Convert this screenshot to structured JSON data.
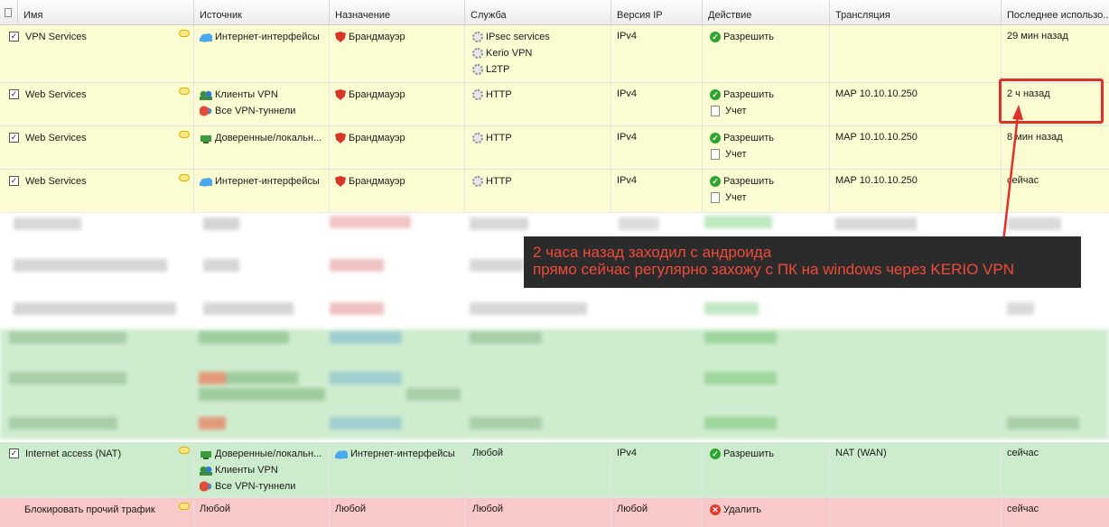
{
  "columns": [
    "Имя",
    "Источник",
    "Назначение",
    "Служба",
    "Версия IP",
    "Действие",
    "Трансляция",
    "Последнее использо..."
  ],
  "rows": [
    {
      "name": "VPN Services",
      "source": [
        "Интернет-интерфейсы"
      ],
      "destination": [
        "Брандмауэр"
      ],
      "service": [
        "IPsec services",
        "Kerio VPN",
        "L2TP"
      ],
      "ip": "IPv4",
      "action": [
        "Разрешить"
      ],
      "translation": "",
      "last": "29 мин назад"
    },
    {
      "name": "Web Services",
      "source": [
        "Клиенты VPN",
        "Все VPN-туннели"
      ],
      "destination": [
        "Брандмауэр"
      ],
      "service": [
        "HTTP"
      ],
      "ip": "IPv4",
      "action": [
        "Разрешить",
        "Учет"
      ],
      "translation": "MAP 10.10.10.250",
      "last": "2 ч назад"
    },
    {
      "name": "Web Services",
      "source": [
        "Доверенные/локальн..."
      ],
      "destination": [
        "Брандмауэр"
      ],
      "service": [
        "HTTP"
      ],
      "ip": "IPv4",
      "action": [
        "Разрешить",
        "Учет"
      ],
      "translation": "MAP 10.10.10.250",
      "last": "8 мин назад"
    },
    {
      "name": "Web Services",
      "source": [
        "Интернет-интерфейсы"
      ],
      "destination": [
        "Брандмауэр"
      ],
      "service": [
        "HTTP"
      ],
      "ip": "IPv4",
      "action": [
        "Разрешить",
        "Учет"
      ],
      "translation": "MAP 10.10.10.250",
      "last": "сейчас"
    },
    {
      "name": "Internet access (NAT)",
      "source": [
        "Доверенные/локальн...",
        "Клиенты VPN",
        "Все VPN-туннели"
      ],
      "destination": [
        "Интернет-интерфейсы"
      ],
      "service": [
        "Любой"
      ],
      "ip": "IPv4",
      "action": [
        "Разрешить"
      ],
      "translation": "NAT (WAN)",
      "last": "сейчас"
    },
    {
      "name": "Блокировать прочий трафик",
      "source": [
        "Любой"
      ],
      "destination": [
        "Любой"
      ],
      "service": [
        "Любой"
      ],
      "ip": "Любой",
      "action": [
        "Удалить"
      ],
      "translation": "",
      "last": "сейчас"
    }
  ],
  "annotation": {
    "line1": "2 часа назад заходил с андроида",
    "line2": "прямо сейчас регулярно захожу с ПК на windows через KERIO VPN"
  },
  "colors": {
    "enabled_row": "#fcfcd2",
    "nat_row": "#cdeccd",
    "block_row": "#f9c9c9",
    "annotation_text": "#f04a3a",
    "highlight": "#e0302a"
  }
}
